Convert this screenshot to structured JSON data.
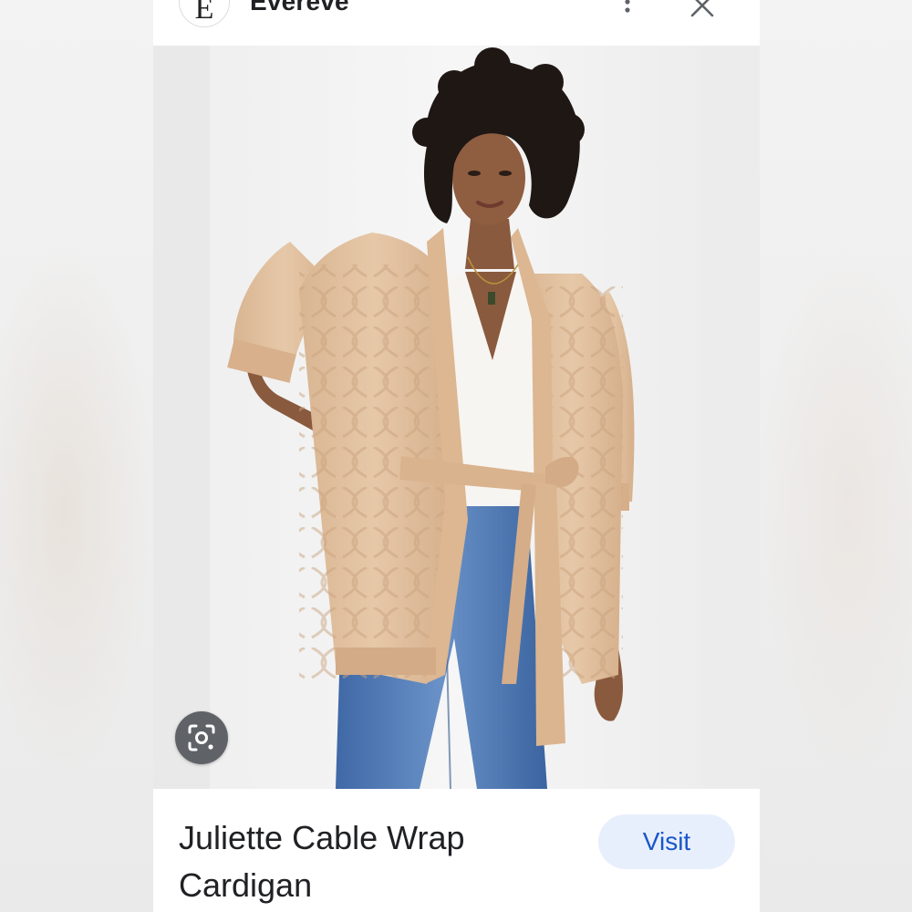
{
  "header": {
    "site_initial": "E",
    "site_name": "Evereve",
    "more_icon": "more-vert-icon",
    "close_icon": "close-icon"
  },
  "image": {
    "alt": "Juliette Cable Wrap Cardigan",
    "lens_icon": "lens-search-icon"
  },
  "product": {
    "title": "Juliette Cable Wrap Cardigan",
    "visit_label": "Visit"
  },
  "colors": {
    "visit_bg": "#e8effc",
    "visit_text": "#1a56c9",
    "cardigan": "#e0c0a0",
    "denim": "#4a74b0",
    "lens_bg": "#5f6368"
  }
}
